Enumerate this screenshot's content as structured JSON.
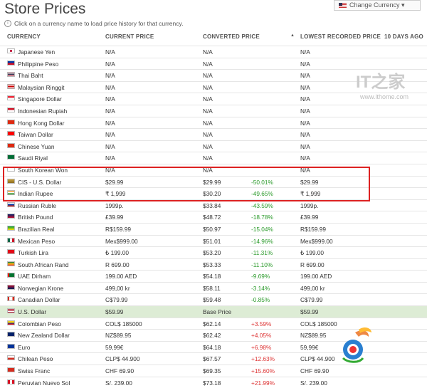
{
  "page_title": "Store Prices",
  "change_currency_label": "Change Currency ▾",
  "hint": "Click on a currency name to load price history for that currency.",
  "columns": {
    "currency": "CURRENCY",
    "current": "CURRENT PRICE",
    "converted": "CONVERTED PRICE",
    "lowest": "LOWEST RECORDED PRICE",
    "ago": "10 DAYS AGO"
  },
  "watermark": {
    "logo": "IT之家",
    "url": "www.ithome.com"
  },
  "rows": [
    {
      "name": "Japanese Yen",
      "current": "N/A",
      "converted": "N/A",
      "diff": "",
      "lowest": "N/A",
      "flag": "jp"
    },
    {
      "name": "Philippine Peso",
      "current": "N/A",
      "converted": "N/A",
      "diff": "",
      "lowest": "N/A",
      "flag": "ph"
    },
    {
      "name": "Thai Baht",
      "current": "N/A",
      "converted": "N/A",
      "diff": "",
      "lowest": "N/A",
      "flag": "th"
    },
    {
      "name": "Malaysian Ringgit",
      "current": "N/A",
      "converted": "N/A",
      "diff": "",
      "lowest": "N/A",
      "flag": "my"
    },
    {
      "name": "Singapore Dollar",
      "current": "N/A",
      "converted": "N/A",
      "diff": "",
      "lowest": "N/A",
      "flag": "sg"
    },
    {
      "name": "Indonesian Rupiah",
      "current": "N/A",
      "converted": "N/A",
      "diff": "",
      "lowest": "N/A",
      "flag": "id"
    },
    {
      "name": "Hong Kong Dollar",
      "current": "N/A",
      "converted": "N/A",
      "diff": "",
      "lowest": "N/A",
      "flag": "hk"
    },
    {
      "name": "Taiwan Dollar",
      "current": "N/A",
      "converted": "N/A",
      "diff": "",
      "lowest": "N/A",
      "flag": "tw"
    },
    {
      "name": "Chinese Yuan",
      "current": "N/A",
      "converted": "N/A",
      "diff": "",
      "lowest": "N/A",
      "flag": "cn"
    },
    {
      "name": "Saudi Riyal",
      "current": "N/A",
      "converted": "N/A",
      "diff": "",
      "lowest": "N/A",
      "flag": "sa"
    },
    {
      "name": "South Korean Won",
      "current": "N/A",
      "converted": "N/A",
      "diff": "",
      "lowest": "N/A",
      "flag": "kr"
    },
    {
      "name": "CIS - U.S. Dollar",
      "current": "$29.99",
      "converted": "$29.99",
      "diff": "-50.01%",
      "lowest": "$29.99",
      "flag": "cis"
    },
    {
      "name": "Indian Rupee",
      "current": "₹ 1,999",
      "converted": "$30.20",
      "diff": "-49.65%",
      "lowest": "₹ 1,999",
      "flag": "in"
    },
    {
      "name": "Russian Ruble",
      "current": "1999р.",
      "converted": "$33.84",
      "diff": "-43.59%",
      "lowest": "1999р.",
      "flag": "ru"
    },
    {
      "name": "British Pound",
      "current": "£39.99",
      "converted": "$48.72",
      "diff": "-18.78%",
      "lowest": "£39.99",
      "flag": "gb"
    },
    {
      "name": "Brazilian Real",
      "current": "R$159.99",
      "converted": "$50.97",
      "diff": "-15.04%",
      "lowest": "R$159.99",
      "flag": "br"
    },
    {
      "name": "Mexican Peso",
      "current": "Mex$999.00",
      "converted": "$51.01",
      "diff": "-14.96%",
      "lowest": "Mex$999.00",
      "flag": "mx"
    },
    {
      "name": "Turkish Lira",
      "current": "₺ 199.00",
      "converted": "$53.20",
      "diff": "-11.31%",
      "lowest": "₺ 199.00",
      "flag": "tr"
    },
    {
      "name": "South African Rand",
      "current": "R 699.00",
      "converted": "$53.33",
      "diff": "-11.10%",
      "lowest": "R 699.00",
      "flag": "za"
    },
    {
      "name": "UAE Dirham",
      "current": "199.00 AED",
      "converted": "$54.18",
      "diff": "-9.69%",
      "lowest": "199.00 AED",
      "flag": "ae"
    },
    {
      "name": "Norwegian Krone",
      "current": "499,00 kr",
      "converted": "$58.11",
      "diff": "-3.14%",
      "lowest": "499,00 kr",
      "flag": "no"
    },
    {
      "name": "Canadian Dollar",
      "current": "C$79.99",
      "converted": "$59.48",
      "diff": "-0.85%",
      "lowest": "C$79.99",
      "flag": "ca"
    },
    {
      "name": "U.S. Dollar",
      "current": "$59.99",
      "converted": "Base Price",
      "diff": "",
      "lowest": "$59.99",
      "flag": "us",
      "base": true
    },
    {
      "name": "Colombian Peso",
      "current": "COL$ 185000",
      "converted": "$62.14",
      "diff": "+3.59%",
      "lowest": "COL$ 185000",
      "flag": "co"
    },
    {
      "name": "New Zealand Dollar",
      "current": "NZ$89.95",
      "converted": "$62.42",
      "diff": "+4.05%",
      "lowest": "NZ$89.95",
      "flag": "nz"
    },
    {
      "name": "Euro",
      "current": "59,99€",
      "converted": "$64.18",
      "diff": "+6.98%",
      "lowest": "59,99€",
      "flag": "eu"
    },
    {
      "name": "Chilean Peso",
      "current": "CLP$ 44.900",
      "converted": "$67.57",
      "diff": "+12.63%",
      "lowest": "CLP$ 44.900",
      "flag": "cl"
    },
    {
      "name": "Swiss Franc",
      "current": "CHF 69.90",
      "converted": "$69.35",
      "diff": "+15.60%",
      "lowest": "CHF 69.90",
      "flag": "ch"
    },
    {
      "name": "Peruvian Nuevo Sol",
      "current": "S/. 239.00",
      "converted": "$73.18",
      "diff": "+21.99%",
      "lowest": "S/. 239.00",
      "flag": "pe"
    }
  ],
  "flag_colors": {
    "jp": "linear-gradient(#fff,#fff)",
    "ph": "linear-gradient(#0038a8 50%,#ce1126 50%)",
    "th": "linear-gradient(#a51931 15%,#fff 15% 35%,#2d2a4a 35% 65%,#fff 65% 85%,#a51931 85%)",
    "my": "repeating-linear-gradient(#cc0001 0 1px,#fff 1px 2px)",
    "sg": "linear-gradient(#ed2939 50%,#fff 50%)",
    "id": "linear-gradient(#ce1126 50%,#fff 50%)",
    "hk": "linear-gradient(#de2910,#de2910)",
    "tw": "linear-gradient(#fe0000,#fe0000)",
    "cn": "linear-gradient(#de2910,#de2910)",
    "sa": "linear-gradient(#006c35,#006c35)",
    "kr": "linear-gradient(#fff,#fff)",
    "cis": "linear-gradient(#c9a23a,#8a6a20)",
    "in": "linear-gradient(#ff9933 33%,#fff 33% 66%,#138808 66%)",
    "ru": "linear-gradient(#fff 33%,#0039a6 33% 66%,#d52b1e 66%)",
    "gb": "linear-gradient(#012169,#c8102e)",
    "br": "linear-gradient(#009c3b,#ffdf00)",
    "mx": "linear-gradient(90deg,#006847 33%,#fff 33% 66%,#ce1126 66%)",
    "tr": "linear-gradient(#e30a17,#e30a17)",
    "za": "linear-gradient(#007a4d,#ffb612 50%,#de3831)",
    "ae": "linear-gradient(90deg,#ff0000 25%,#00732f 25%)",
    "no": "linear-gradient(#ba0c2f,#00205b)",
    "ca": "linear-gradient(90deg,#d52b1e 25%,#fff 25% 75%,#d52b1e 75%)",
    "us": "repeating-linear-gradient(#b22234 0 1px,#fff 1px 2px)",
    "co": "linear-gradient(#fcd116 50%,#003893 50% 75%,#ce1126 75%)",
    "nz": "linear-gradient(#012169,#012169)",
    "eu": "linear-gradient(#003399,#003399)",
    "cl": "linear-gradient(#fff 50%,#d52b1e 50%)",
    "ch": "linear-gradient(#d52b1e,#d52b1e)",
    "pe": "linear-gradient(90deg,#d91023 33%,#fff 33% 66%,#d91023 66%)"
  }
}
